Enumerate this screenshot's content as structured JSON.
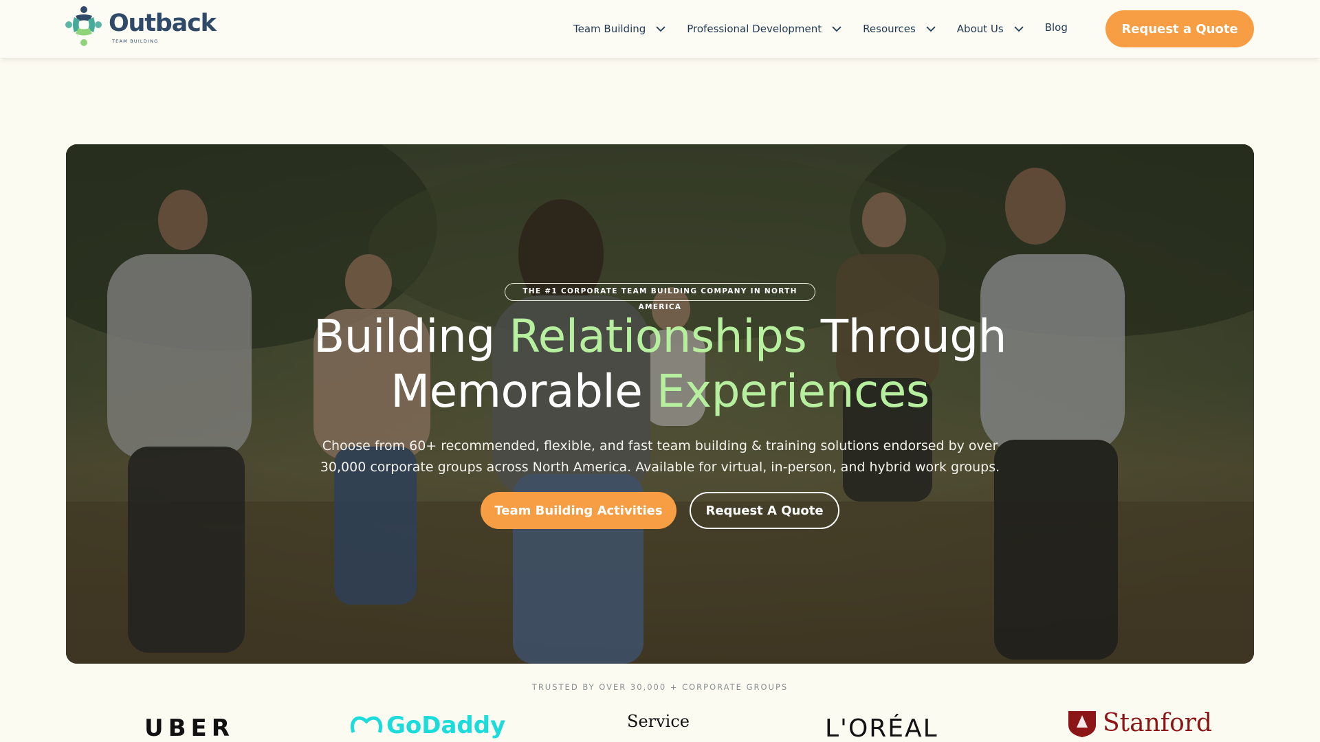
{
  "header": {
    "logo_text": "Outback",
    "logo_subtext": "TEAM BUILDING",
    "nav": [
      {
        "label": "Team Building",
        "has_dropdown": true
      },
      {
        "label": "Professional Development",
        "has_dropdown": true
      },
      {
        "label": "Resources",
        "has_dropdown": true
      },
      {
        "label": "About Us",
        "has_dropdown": true
      },
      {
        "label": "Blog",
        "has_dropdown": false
      }
    ],
    "cta_label": "Request a Quote"
  },
  "hero": {
    "eyebrow": "THE #1 CORPORATE TEAM BUILDING COMPANY IN NORTH AMERICA",
    "headline": {
      "w1": "Building",
      "w2": "Relationships",
      "w3": "Through",
      "w4": "Memorable",
      "w5": "Experiences"
    },
    "subtext_line1": "Choose from 60+ recommended, flexible, and fast team building & training solutions endorsed by over",
    "subtext_line2": "30,000 corporate groups across North America. Available for virtual, in-person, and hybrid work groups.",
    "primary_button": "Team Building Activities",
    "secondary_button": "Request A Quote"
  },
  "trusted": {
    "label": "TRUSTED BY OVER 30,000 + CORPORATE GROUPS",
    "brands": [
      "UBER",
      "GoDaddy",
      "Service",
      "L'ORÉAL",
      "Stanford"
    ]
  },
  "colors": {
    "accent_orange": "#f79e45",
    "highlight_green": "#b6f09f",
    "navy": "#2e4a68",
    "background": "#fcfbf1"
  },
  "icons": {
    "logo": "people-circle-logo-icon",
    "dropdown": "chevron-down-icon"
  }
}
